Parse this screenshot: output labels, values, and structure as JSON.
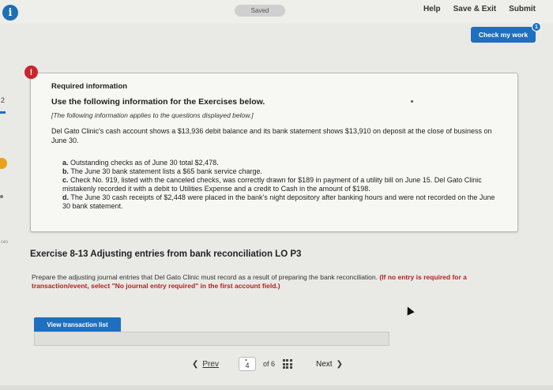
{
  "topbar": {
    "saved_label": "Saved",
    "help_label": "Help",
    "save_exit_label": "Save & Exit",
    "submit_label": "Submit",
    "check_my_work_label": "Check my work",
    "check_badge": "1"
  },
  "left_strip": {
    "question_num": "2",
    "ces_text": "ces"
  },
  "info": {
    "alert_symbol": "!",
    "required": "Required information",
    "use": "Use the following information for the Exercises below.",
    "applies": "[The following information applies to the questions displayed below.]",
    "paragraph": "Del Gato Clinic's cash account shows a $13,936 debit balance and its bank statement shows $13,910 on deposit at the close of business on June 30.",
    "items": [
      {
        "label": "a.",
        "text": "Outstanding checks as of June 30 total $2,478."
      },
      {
        "label": "b.",
        "text": "The June 30 bank statement lists a $65 bank service charge."
      },
      {
        "label": "c.",
        "text": "Check No. 919, listed with the canceled checks, was correctly drawn for $189 in payment of a utility bill on June 15. Del Gato Clinic mistakenly recorded it with a debit to Utilities Expense and a credit to Cash in the amount of $198."
      },
      {
        "label": "d.",
        "text": "The June 30 cash receipts of $2,448 were placed in the bank's night depository after banking hours and were not recorded on the June 30 bank statement."
      }
    ]
  },
  "exercise": {
    "title": "Exercise 8-13 Adjusting entries from bank reconciliation LO P3",
    "prepare_text": "Prepare the adjusting journal entries that Del Gato Clinic must record as a result of preparing the bank reconciliation.",
    "prepare_red": "(If no entry is required for a transaction/event, select \"No journal entry required\" in the first account field.)",
    "view_button": "View transaction list"
  },
  "pager": {
    "prev_label": "Prev",
    "current_page": "4",
    "of_label": "of 6",
    "next_label": "Next"
  },
  "colors": {
    "accent_blue": "#1f6fbf",
    "alert_red": "#c8262a",
    "warning_orange": "#e8a21a"
  }
}
